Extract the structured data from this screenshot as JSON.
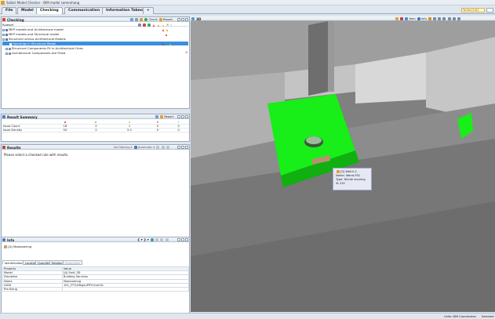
{
  "app": {
    "title": "Solibri Model Checker - BIM model samenhang"
  },
  "menu": {
    "tabs": [
      {
        "label": "File"
      },
      {
        "label": "Model"
      },
      {
        "label": "Checking"
      },
      {
        "label": "Communication"
      },
      {
        "label": "Information Takeoff"
      },
      {
        "label": "+"
      }
    ],
    "todo_label": "To-Do [1/4]"
  },
  "checking": {
    "title": "Checking",
    "check_label": "Check",
    "report_label": "Report",
    "ruleset_label": "Ruleset",
    "rows": [
      {
        "label": "MEP models and Architectural model"
      },
      {
        "label": "MEP models and Structural model"
      },
      {
        "label": "Structural versus Architectural Models"
      },
      {
        "label": "Openings in Structural Model"
      },
      {
        "label": "Structural Components Fit in Architectural Ones"
      },
      {
        "label": "Architectural Components Are Filled"
      }
    ]
  },
  "summary": {
    "title": "Result Summary",
    "report_label": "Report",
    "rows": [
      {
        "label": "Issue Count",
        "values": [
          "18",
          "0",
          "1",
          "0",
          "0"
        ]
      },
      {
        "label": "Issue Density",
        "values": [
          "94",
          "0",
          "5.0",
          "0",
          "0"
        ]
      }
    ]
  },
  "results": {
    "title": "Results",
    "filtering_label": "No Filtering",
    "auto_label": "Automatic",
    "message": "Please select a checked rule with results."
  },
  "info": {
    "title": "Info",
    "item_name": "[A] Maaivoering",
    "tabs": [
      "Identification",
      "Location",
      "Quantities",
      "Relations",
      "Hyperlinks"
    ],
    "headers": [
      "Property",
      "Value"
    ],
    "rows": [
      {
        "property": "Model",
        "value": "[A] Smit_3D"
      },
      {
        "property": "Discipline",
        "value": "Building Services"
      },
      {
        "property": "Name",
        "value": "Maaivoering"
      },
      {
        "property": "GUID",
        "value": "1S1_f7Y1k9kgxuP9Yn1sm3z"
      },
      {
        "property": "Pre-fixing",
        "value": ""
      }
    ]
  },
  "view3d": {
    "title": "3D",
    "item_label": "Item",
    "info_label": "Info"
  },
  "tooltip": {
    "title": "[S] Wall.0.2",
    "name_line": "Name: Wand-931",
    "type_line": "Type: Dichte wvoring",
    "extra_line": "St 210"
  },
  "status": {
    "right_text": "Units: BIM Coordinates",
    "right_text2": "Selected"
  },
  "colors": {
    "accent": "#3b8fe0",
    "highlight_green": "#18ee18",
    "critical": "#d22222",
    "moderate": "#ee8a00",
    "low": "#e6c000"
  }
}
